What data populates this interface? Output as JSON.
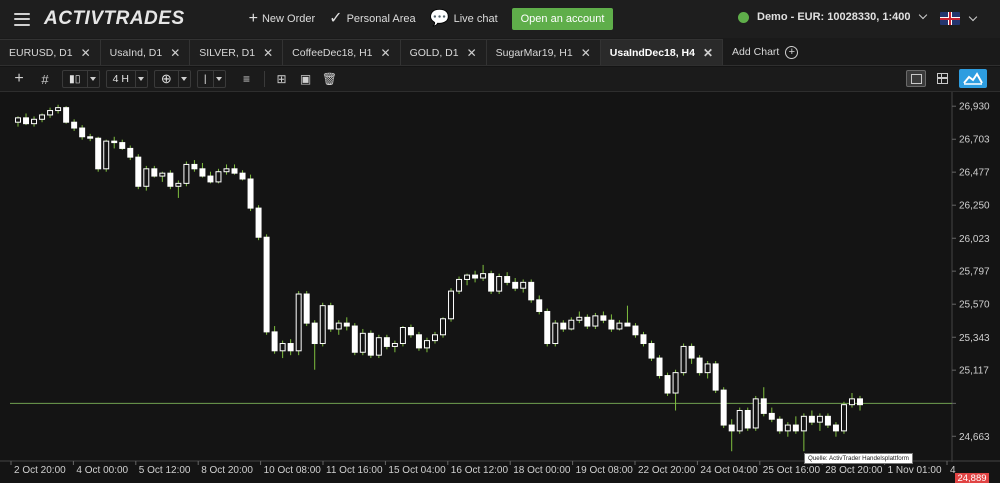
{
  "topbar": {
    "logo": "ACTIVTRADES",
    "new_order": "New Order",
    "personal_area": "Personal Area",
    "live_chat": "Live chat",
    "open_account": "Open an account",
    "account": "Demo - EUR: 10028330, 1:400"
  },
  "tabs": [
    {
      "label": "EURUSD, D1"
    },
    {
      "label": "UsaInd, D1"
    },
    {
      "label": "SILVER, D1"
    },
    {
      "label": "CoffeeDec18, H1"
    },
    {
      "label": "GOLD, D1"
    },
    {
      "label": "SugarMar19, H1"
    },
    {
      "label": "UsaIndDec18, H4",
      "active": true
    },
    {
      "label": "Add Chart"
    }
  ],
  "toolbar": {
    "timeframe": "4 H"
  },
  "chart": {
    "source_label": "Quelle: ActivTrader Handelsplattform",
    "current_price": "24,889",
    "price_ticks": [
      "26,930",
      "26,703",
      "26,477",
      "26,250",
      "26,023",
      "25,797",
      "25,570",
      "25,343",
      "25,117",
      "24,889",
      "24,663"
    ],
    "time_ticks": [
      "2 Oct 20:00",
      "4 Oct 00:00",
      "5 Oct 12:00",
      "8 Oct 20:00",
      "10 Oct 08:00",
      "11 Oct 16:00",
      "15 Oct 04:00",
      "16 Oct 12:00",
      "18 Oct 00:00",
      "19 Oct 08:00",
      "22 Oct 20:00",
      "24 Oct 04:00",
      "25 Oct 16:00",
      "28 Oct 20:00",
      "1 Nov 01:00",
      "4"
    ]
  },
  "colors": {
    "up_candle": "#ffffff",
    "down_candle": "#ffffff",
    "wick": "#7fbf3f",
    "price_line": "#6f9f4f",
    "accent_green": "#5fae4a",
    "price_tag": "#e04343",
    "button_blue": "#2d9de0"
  },
  "chart_data": {
    "type": "candlestick",
    "symbol": "UsaIndDec18",
    "timeframe": "H4",
    "ylim": [
      24500,
      27000
    ],
    "current_price": 24889,
    "candles": [
      [
        26820,
        26860,
        26790,
        26850
      ],
      [
        26850,
        26880,
        26800,
        26810
      ],
      [
        26810,
        26860,
        26790,
        26840
      ],
      [
        26840,
        26880,
        26820,
        26870
      ],
      [
        26870,
        26920,
        26850,
        26900
      ],
      [
        26900,
        26940,
        26880,
        26920
      ],
      [
        26920,
        26930,
        26810,
        26820
      ],
      [
        26820,
        26840,
        26760,
        26780
      ],
      [
        26780,
        26800,
        26700,
        26720
      ],
      [
        26720,
        26740,
        26690,
        26710
      ],
      [
        26710,
        26720,
        26480,
        26500
      ],
      [
        26500,
        26700,
        26480,
        26690
      ],
      [
        26690,
        26720,
        26640,
        26680
      ],
      [
        26680,
        26700,
        26630,
        26640
      ],
      [
        26640,
        26660,
        26560,
        26580
      ],
      [
        26580,
        26600,
        26360,
        26380
      ],
      [
        26380,
        26520,
        26350,
        26500
      ],
      [
        26500,
        26520,
        26440,
        26450
      ],
      [
        26450,
        26480,
        26410,
        26470
      ],
      [
        26470,
        26490,
        26360,
        26380
      ],
      [
        26380,
        26420,
        26300,
        26400
      ],
      [
        26400,
        26550,
        26380,
        26530
      ],
      [
        26530,
        26560,
        26480,
        26500
      ],
      [
        26500,
        26540,
        26440,
        26450
      ],
      [
        26450,
        26480,
        26400,
        26410
      ],
      [
        26410,
        26500,
        26400,
        26480
      ],
      [
        26480,
        26530,
        26460,
        26500
      ],
      [
        26500,
        26530,
        26460,
        26470
      ],
      [
        26470,
        26490,
        26420,
        26430
      ],
      [
        26430,
        26460,
        26210,
        26230
      ],
      [
        26230,
        26250,
        26010,
        26030
      ],
      [
        26030,
        26050,
        25360,
        25380
      ],
      [
        25380,
        25420,
        25230,
        25250
      ],
      [
        25250,
        25320,
        25200,
        25300
      ],
      [
        25300,
        25330,
        25220,
        25250
      ],
      [
        25250,
        25660,
        25220,
        25640
      ],
      [
        25640,
        25660,
        25420,
        25440
      ],
      [
        25440,
        25460,
        25120,
        25300
      ],
      [
        25300,
        25580,
        25280,
        25560
      ],
      [
        25560,
        25580,
        25380,
        25400
      ],
      [
        25400,
        25460,
        25360,
        25440
      ],
      [
        25440,
        25480,
        25390,
        25420
      ],
      [
        25420,
        25440,
        25220,
        25240
      ],
      [
        25240,
        25400,
        25220,
        25370
      ],
      [
        25370,
        25390,
        25200,
        25220
      ],
      [
        25220,
        25360,
        25200,
        25340
      ],
      [
        25340,
        25360,
        25260,
        25280
      ],
      [
        25280,
        25320,
        25240,
        25300
      ],
      [
        25300,
        25420,
        25280,
        25410
      ],
      [
        25410,
        25430,
        25340,
        25360
      ],
      [
        25360,
        25380,
        25250,
        25270
      ],
      [
        25270,
        25340,
        25240,
        25320
      ],
      [
        25320,
        25380,
        25300,
        25360
      ],
      [
        25360,
        25480,
        25340,
        25470
      ],
      [
        25470,
        25680,
        25450,
        25660
      ],
      [
        25660,
        25760,
        25640,
        25740
      ],
      [
        25740,
        25780,
        25700,
        25770
      ],
      [
        25770,
        25800,
        25720,
        25750
      ],
      [
        25750,
        25840,
        25730,
        25780
      ],
      [
        25780,
        25800,
        25640,
        25660
      ],
      [
        25660,
        25780,
        25640,
        25760
      ],
      [
        25760,
        25790,
        25700,
        25720
      ],
      [
        25720,
        25750,
        25660,
        25680
      ],
      [
        25680,
        25740,
        25650,
        25720
      ],
      [
        25720,
        25740,
        25580,
        25600
      ],
      [
        25600,
        25630,
        25500,
        25520
      ],
      [
        25520,
        25540,
        25280,
        25300
      ],
      [
        25300,
        25460,
        25280,
        25440
      ],
      [
        25440,
        25460,
        25380,
        25400
      ],
      [
        25400,
        25480,
        25390,
        25460
      ],
      [
        25460,
        25520,
        25440,
        25480
      ],
      [
        25480,
        25500,
        25400,
        25420
      ],
      [
        25420,
        25510,
        25400,
        25490
      ],
      [
        25490,
        25520,
        25440,
        25460
      ],
      [
        25460,
        25500,
        25380,
        25400
      ],
      [
        25400,
        25460,
        25390,
        25440
      ],
      [
        25440,
        25560,
        25420,
        25420
      ],
      [
        25420,
        25440,
        25340,
        25360
      ],
      [
        25360,
        25380,
        25280,
        25300
      ],
      [
        25300,
        25320,
        25180,
        25200
      ],
      [
        25200,
        25220,
        25060,
        25080
      ],
      [
        25080,
        25100,
        24940,
        24960
      ],
      [
        24960,
        25120,
        24840,
        25100
      ],
      [
        25100,
        25300,
        25080,
        25280
      ],
      [
        25280,
        25300,
        25160,
        25200
      ],
      [
        25200,
        25220,
        25080,
        25100
      ],
      [
        25100,
        25180,
        25060,
        25160
      ],
      [
        25160,
        25180,
        24960,
        24980
      ],
      [
        24980,
        25000,
        24720,
        24740
      ],
      [
        24740,
        24780,
        24560,
        24700
      ],
      [
        24700,
        24860,
        24680,
        24840
      ],
      [
        24840,
        24860,
        24700,
        24720
      ],
      [
        24720,
        24940,
        24700,
        24920
      ],
      [
        24920,
        25000,
        24800,
        24820
      ],
      [
        24820,
        24860,
        24760,
        24780
      ],
      [
        24780,
        24800,
        24680,
        24700
      ],
      [
        24700,
        24760,
        24660,
        24740
      ],
      [
        24740,
        24800,
        24680,
        24700
      ],
      [
        24700,
        24820,
        24560,
        24800
      ],
      [
        24800,
        24840,
        24740,
        24760
      ],
      [
        24760,
        24820,
        24700,
        24800
      ],
      [
        24800,
        24820,
        24720,
        24740
      ],
      [
        24740,
        24760,
        24660,
        24700
      ],
      [
        24700,
        24900,
        24680,
        24880
      ],
      [
        24880,
        24960,
        24860,
        24920
      ],
      [
        24920,
        24940,
        24840,
        24880
      ]
    ]
  }
}
